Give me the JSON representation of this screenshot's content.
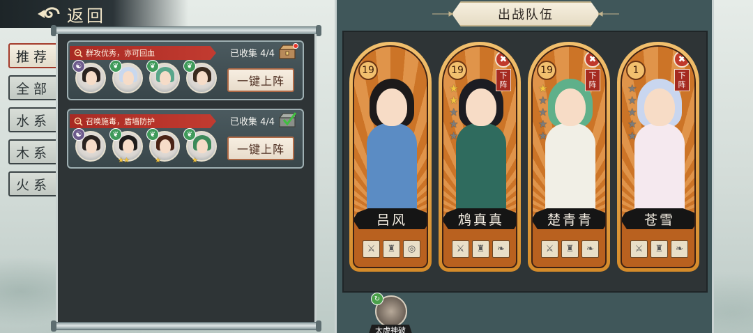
{
  "header": {
    "back_label": "返回"
  },
  "filters": [
    {
      "label": "推荐",
      "active": true
    },
    {
      "label": "全部",
      "active": false
    },
    {
      "label": "水系",
      "active": false
    },
    {
      "label": "木系",
      "active": false
    },
    {
      "label": "火系",
      "active": false
    }
  ],
  "recommendations": [
    {
      "tag": "群攻优秀，亦可回血",
      "collected": "已收集 4/4",
      "deploy_label": "一键上阵",
      "chest_icon": "treasure-chest-icon",
      "members": [
        {
          "element": "yin-yang",
          "element_color": "#6c5a8c",
          "hair": "#2a2320",
          "stars": ""
        },
        {
          "element": "leaf",
          "element_color": "#3f9a5a",
          "hair": "#c9d8ee",
          "stars": ""
        },
        {
          "element": "leaf",
          "element_color": "#3f9a5a",
          "hair": "#59a68a",
          "stars": ""
        },
        {
          "element": "leaf",
          "element_color": "#3f9a5a",
          "hair": "#3a2a1e",
          "stars": ""
        }
      ]
    },
    {
      "tag": "召唤施毒，盾墙防护",
      "collected": "已收集 4/4",
      "deploy_label": "一键上阵",
      "chest_icon": "checked-chest-icon",
      "members": [
        {
          "element": "yin-yang",
          "element_color": "#6c5a8c",
          "hair": "#2a2320",
          "stars": ""
        },
        {
          "element": "leaf",
          "element_color": "#3f9a5a",
          "hair": "#1e1c1c",
          "stars": "★★"
        },
        {
          "element": "leaf",
          "element_color": "#3f9a5a",
          "hair": "#4a2316",
          "stars": "★"
        },
        {
          "element": "leaf",
          "element_color": "#3f9a5a",
          "hair": "#3d8a5a",
          "stars": "★"
        }
      ]
    }
  ],
  "team": {
    "title": "出战队伍",
    "remove_label": "下阵",
    "heroes": [
      {
        "name": "吕风",
        "level": "19",
        "stars_on": 0,
        "stars_total": 0,
        "removable": false,
        "hair": "#1d1a1a",
        "outfit": "#5b8cc4"
      },
      {
        "name": "鸩真真",
        "level": "19",
        "stars_on": 2,
        "stars_total": 5,
        "removable": true,
        "hair": "#1c1c22",
        "outfit": "#2f6b5e"
      },
      {
        "name": "楚青青",
        "level": "19",
        "stars_on": 1,
        "stars_total": 5,
        "removable": true,
        "hair": "#5fb08a",
        "outfit": "#f1efe6"
      },
      {
        "name": "苍雪",
        "level": "1",
        "stars_on": 0,
        "stars_total": 5,
        "removable": true,
        "hair": "#c9d6ef",
        "outfit": "#f5e9ef"
      }
    ]
  },
  "skill": {
    "name": "太虚神破",
    "icon": "taixu-skill-icon"
  }
}
